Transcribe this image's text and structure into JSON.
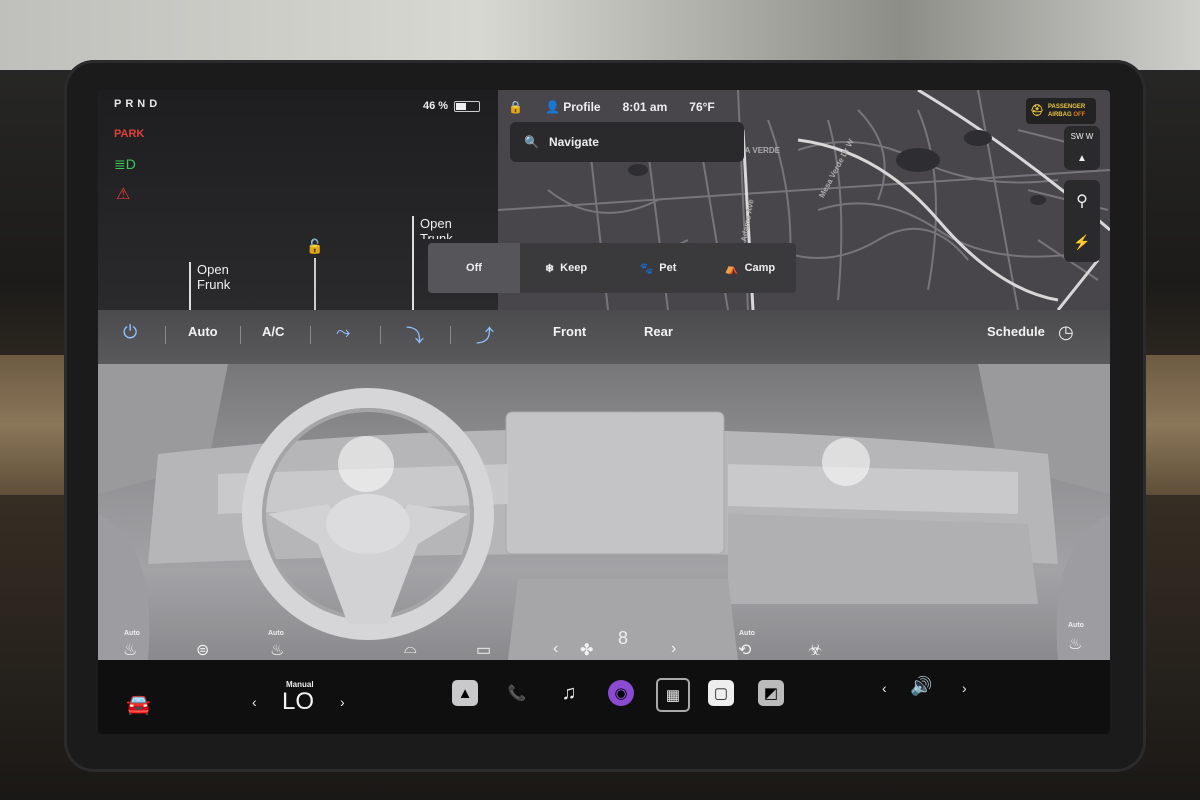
{
  "gear": {
    "prnd": "PRND",
    "park": "PARK"
  },
  "status": {
    "battery_percent": "46 %",
    "battery_level": 0.46,
    "profile_label": "Profile",
    "time": "8:01 am",
    "temperature": "76°F"
  },
  "trunk": {
    "front_label_line1": "Open",
    "front_label_line2": "Frunk",
    "rear_label_line1": "Open",
    "rear_label_line2": "Trunk"
  },
  "map": {
    "search_placeholder": "Navigate",
    "area_label": "ESA VERDE",
    "street_label_1": "Adams Ave",
    "street_label_2": "Mesa Verde Dr W"
  },
  "airbag": {
    "line1": "PASSENGER",
    "line2_prefix": "AIRBAG ",
    "line2_state": "OFF"
  },
  "compass": {
    "letters": "SW W"
  },
  "modes": {
    "off": "Off",
    "keep": "Keep",
    "pet": "Pet",
    "camp": "Camp"
  },
  "climate": {
    "auto": "Auto",
    "ac": "A/C",
    "front": "Front",
    "rear": "Rear",
    "schedule": "Schedule",
    "fan_speed": "8",
    "auto_tag": "Auto"
  },
  "dock": {
    "temp_mode": "Manual",
    "temp_value": "LO"
  },
  "colors": {
    "accent_blue": "#8fc2ff",
    "park_red": "#e0403a",
    "light_green": "#3ec95b",
    "airbag_yellow": "#e7c640"
  }
}
